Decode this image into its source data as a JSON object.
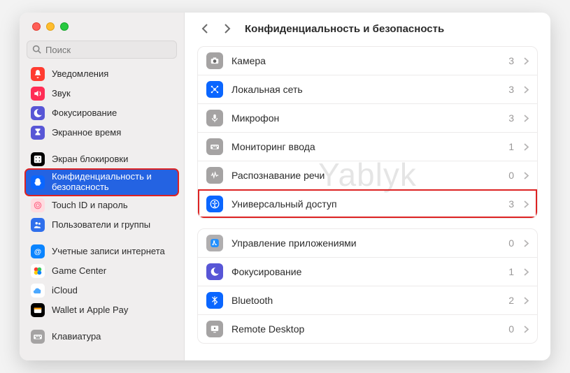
{
  "window": {
    "os": "macOS",
    "app": "System Settings"
  },
  "search": {
    "placeholder": "Поиск"
  },
  "sidebar": {
    "groups": [
      {
        "items": [
          {
            "name": "notifications",
            "label": "Уведомления",
            "icon": "bell-icon",
            "bg": "#ff3b30"
          },
          {
            "name": "sound",
            "label": "Звук",
            "icon": "speaker-icon",
            "bg": "#ff2d55"
          },
          {
            "name": "focus",
            "label": "Фокусирование",
            "icon": "moon-icon",
            "bg": "#5856d6"
          },
          {
            "name": "screen-time",
            "label": "Экранное время",
            "icon": "hourglass-icon",
            "bg": "#5856d6"
          }
        ]
      },
      {
        "items": [
          {
            "name": "lock-screen",
            "label": "Экран блокировки",
            "icon": "lock-screen-icon",
            "bg": "#000"
          },
          {
            "name": "privacy-security",
            "label": "Конфиденциальность и безопасность",
            "icon": "hand-icon",
            "bg": "#0a66ff",
            "selected": true,
            "highlight": true
          },
          {
            "name": "touch-id",
            "label": "Touch ID и пароль",
            "icon": "fingerprint-icon",
            "bg": "#ffdbe0"
          },
          {
            "name": "users-groups",
            "label": "Пользователи и группы",
            "icon": "users-icon",
            "bg": "#2f6fec"
          }
        ]
      },
      {
        "items": [
          {
            "name": "internet-accounts",
            "label": "Учетные записи интернета",
            "icon": "at-icon",
            "bg": "#0a84ff"
          },
          {
            "name": "game-center",
            "label": "Game Center",
            "icon": "game-icon",
            "bg": "#ffffff"
          },
          {
            "name": "icloud",
            "label": "iCloud",
            "icon": "cloud-icon",
            "bg": "#ffffff"
          },
          {
            "name": "wallet",
            "label": "Wallet и Apple Pay",
            "icon": "wallet-icon",
            "bg": "#000"
          }
        ]
      },
      {
        "items": [
          {
            "name": "keyboard",
            "label": "Клавиатура",
            "icon": "keyboard-icon",
            "bg": "#a5a3a3"
          }
        ]
      }
    ]
  },
  "header": {
    "title": "Конфиденциальность и безопасность"
  },
  "main": {
    "groups": [
      {
        "rows": [
          {
            "name": "camera",
            "label": "Камера",
            "count": "3",
            "icon": "camera-icon",
            "bg": "#a5a3a3"
          },
          {
            "name": "local-network",
            "label": "Локальная сеть",
            "count": "3",
            "icon": "network-icon",
            "bg": "#0a66ff"
          },
          {
            "name": "microphone",
            "label": "Микрофон",
            "count": "3",
            "icon": "mic-icon",
            "bg": "#a5a3a3"
          },
          {
            "name": "input-monitoring",
            "label": "Мониторинг ввода",
            "count": "1",
            "icon": "keyboard-small-icon",
            "bg": "#a5a3a3"
          },
          {
            "name": "speech-recognition",
            "label": "Распознавание речи",
            "count": "0",
            "icon": "waveform-icon",
            "bg": "#a5a3a3"
          },
          {
            "name": "accessibility",
            "label": "Универсальный доступ",
            "count": "3",
            "icon": "accessibility-icon",
            "bg": "#0a66ff",
            "highlight": true
          }
        ]
      },
      {
        "rows": [
          {
            "name": "app-management",
            "label": "Управление приложениями",
            "count": "0",
            "icon": "app-mgmt-icon",
            "bg": "#b0aeaf"
          },
          {
            "name": "focus-row",
            "label": "Фокусирование",
            "count": "1",
            "icon": "moon-icon",
            "bg": "#5856d6"
          },
          {
            "name": "bluetooth",
            "label": "Bluetooth",
            "count": "2",
            "icon": "bluetooth-icon",
            "bg": "#0a66ff"
          },
          {
            "name": "remote-desktop",
            "label": "Remote Desktop",
            "count": "0",
            "icon": "remote-icon",
            "bg": "#a5a3a3"
          }
        ]
      }
    ]
  },
  "watermark": "Yablyk",
  "icons": {
    "bell-icon": "bell",
    "speaker-icon": "speaker",
    "moon-icon": "moon",
    "hourglass-icon": "hourglass",
    "lock-screen-icon": "lockscreen",
    "hand-icon": "hand",
    "fingerprint-icon": "fingerprint",
    "users-icon": "users",
    "at-icon": "at",
    "game-icon": "game",
    "cloud-icon": "cloud",
    "wallet-icon": "wallet",
    "keyboard-icon": "keyboard",
    "camera-icon": "camera",
    "network-icon": "network",
    "mic-icon": "mic",
    "keyboard-small-icon": "keyboard",
    "waveform-icon": "wave",
    "accessibility-icon": "accessibility",
    "app-mgmt-icon": "appstore",
    "bluetooth-icon": "bluetooth",
    "remote-icon": "remote"
  }
}
